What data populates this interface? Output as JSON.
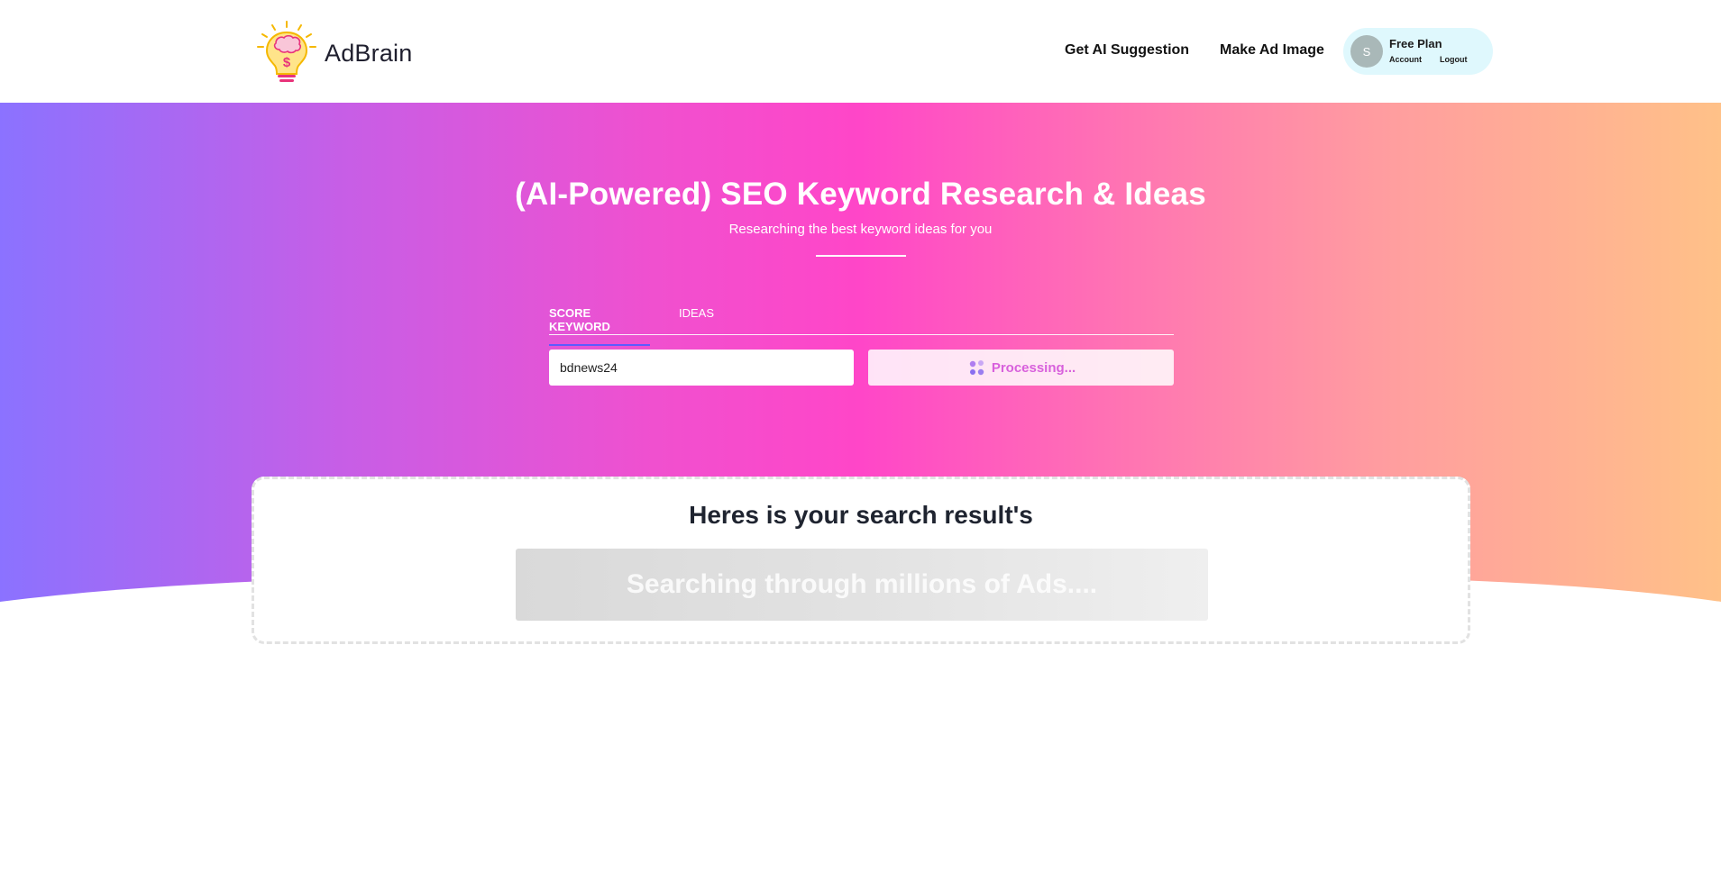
{
  "brand": {
    "name": "AdBrain",
    "logo_icon": "lightbulb-brain-dollar-icon"
  },
  "nav": {
    "ai_suggestion": "Get AI Suggestion",
    "ad_image": "Make Ad Image"
  },
  "user": {
    "avatar_initial": "S",
    "plan": "Free Plan",
    "account_label": "Account",
    "logout_label": "Logout"
  },
  "hero": {
    "title": "(AI-Powered) SEO Keyword Research & Ideas",
    "subtitle": "Researching the best keyword ideas for you"
  },
  "tabs": [
    {
      "label": "SCORE KEYWORD",
      "active": true
    },
    {
      "label": "IDEAS",
      "active": false
    }
  ],
  "search": {
    "value": "bdnews24",
    "button_label": "Processing...",
    "button_icon": "loading-spinner-icon"
  },
  "results": {
    "title": "Heres is your search result's",
    "placeholder": "Searching through millions of Ads...."
  },
  "colors": {
    "gradient_start": "#8b72ff",
    "gradient_mid": "#ff46c8",
    "gradient_end": "#ffc188",
    "tab_active_underline": "#5b5bff",
    "processing_text": "#d860dc",
    "user_pill_bg": "#dff8fd"
  }
}
